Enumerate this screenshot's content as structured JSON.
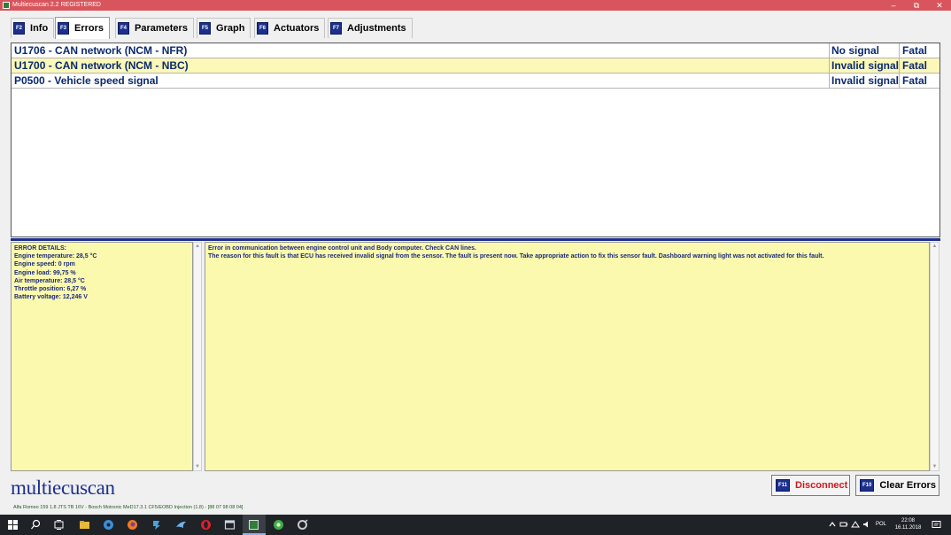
{
  "window": {
    "title": "Multiecuscan 2.2 REGISTERED",
    "minimize_glyph": "–",
    "maximize_glyph": "⧉",
    "close_glyph": "✕"
  },
  "tabs": [
    {
      "key": "F2",
      "label": "Info"
    },
    {
      "key": "F3",
      "label": "Errors",
      "active": true
    },
    {
      "key": "F4",
      "label": "Parameters"
    },
    {
      "key": "F5",
      "label": "Graph"
    },
    {
      "key": "F6",
      "label": "Actuators"
    },
    {
      "key": "F7",
      "label": "Adjustments"
    }
  ],
  "errors": [
    {
      "description": "U1706 - CAN network (NCM - NFR)",
      "status": "No signal",
      "severity": "Fatal"
    },
    {
      "description": "U1700 - CAN network (NCM - NBC)",
      "status": "Invalid signal",
      "severity": "Fatal"
    },
    {
      "description": "P0500 - Vehicle speed signal",
      "status": "Invalid signal",
      "severity": "Fatal"
    }
  ],
  "error_details": {
    "heading": "ERROR DETAILS:",
    "lines": [
      "Engine temperature: 28,5 °C",
      "Engine speed: 0 rpm",
      "Engine load: 99,75 %",
      "Air temperature: 28,5 °C",
      "Throttle position: 6,27 %",
      "Battery voltage: 12,246 V"
    ]
  },
  "error_description": {
    "line1": "Error in communication between engine control unit and Body computer. Check CAN lines.",
    "line2": "The reason for this fault is that ECU has received invalid signal from the sensor. The fault is present now. Take appropriate action to fix this sensor fault. Dashboard warning light was not activated for this fault."
  },
  "logo": "multiecuscan",
  "buttons": {
    "disconnect": {
      "key": "F11",
      "label": "Disconnect"
    },
    "clear_errors": {
      "key": "F10",
      "label": "Clear Errors"
    }
  },
  "status_line": "Alfa Romeo 159 1.8 JTS TB 16V - Bosch Motronic MeD17.3.1 CF5/EOBD Injection (1.8) - [88 07 98 08 04]",
  "taskbar": {
    "language": "POL",
    "time": "22:08",
    "date": "16.11.2018"
  },
  "colors": {
    "titlebar": "#d9555d",
    "fkey_badge": "#1c2f8e",
    "error_text": "#0a2a6e",
    "highlight_row": "#fbf8b8",
    "details_bg": "#fbf9ae",
    "disconnect_text": "#d4161c"
  }
}
